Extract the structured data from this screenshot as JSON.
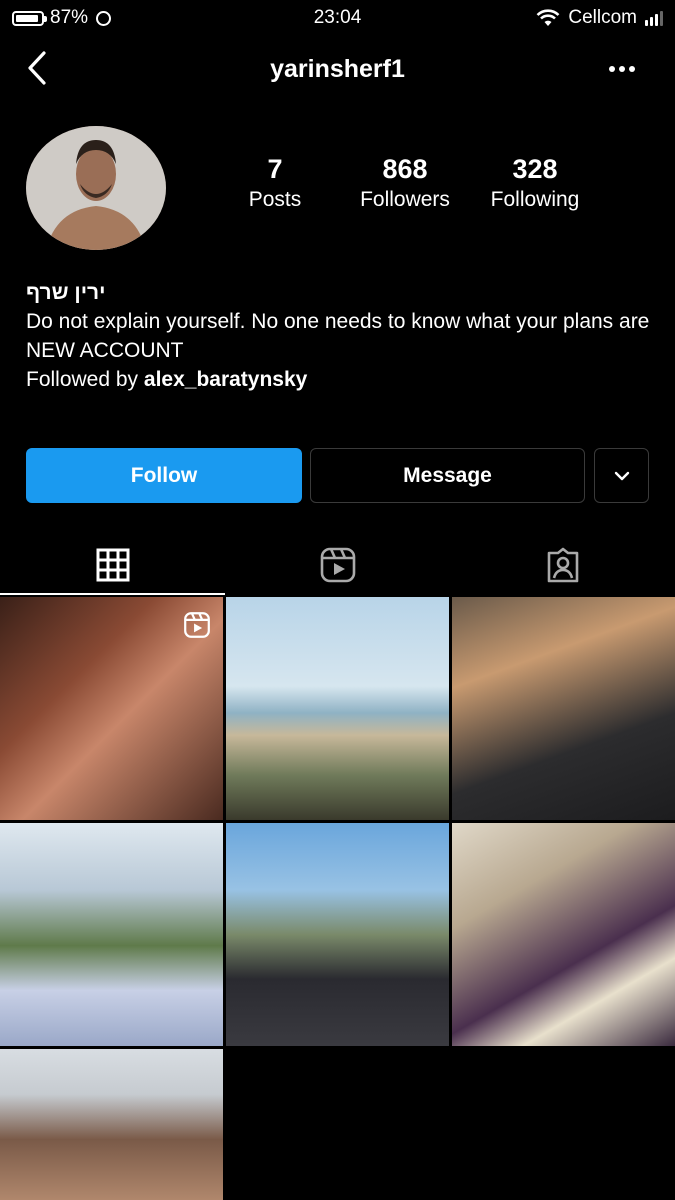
{
  "status": {
    "battery": "87%",
    "time": "23:04",
    "carrier": "Cellcom"
  },
  "header": {
    "username": "yarinsherf1",
    "back_icon": "chevron-left-icon",
    "more_icon": "more-horizontal-icon"
  },
  "profile": {
    "stats": [
      {
        "value": "7",
        "label": "Posts"
      },
      {
        "value": "868",
        "label": "Followers"
      },
      {
        "value": "328",
        "label": "Following"
      }
    ],
    "display_name": "ירין שרף",
    "bio_line1": "Do not explain yourself. No one needs to know what your plans are",
    "bio_line2": "NEW ACCOUNT",
    "followed_by_prefix": "Followed by ",
    "followed_by_user": "alex_baratynsky"
  },
  "actions": {
    "follow_label": "Follow",
    "message_label": "Message",
    "accent_color": "#1a9af0"
  },
  "tabs": [
    {
      "name": "posts-grid",
      "icon": "grid-icon",
      "active": true
    },
    {
      "name": "reels",
      "icon": "reels-icon",
      "active": false
    },
    {
      "name": "tagged",
      "icon": "tagged-icon",
      "active": false
    }
  ],
  "posts": [
    {
      "kind": "reel"
    },
    {
      "kind": "photo"
    },
    {
      "kind": "photo"
    },
    {
      "kind": "photo"
    },
    {
      "kind": "photo"
    },
    {
      "kind": "photo"
    },
    {
      "kind": "photo"
    }
  ]
}
